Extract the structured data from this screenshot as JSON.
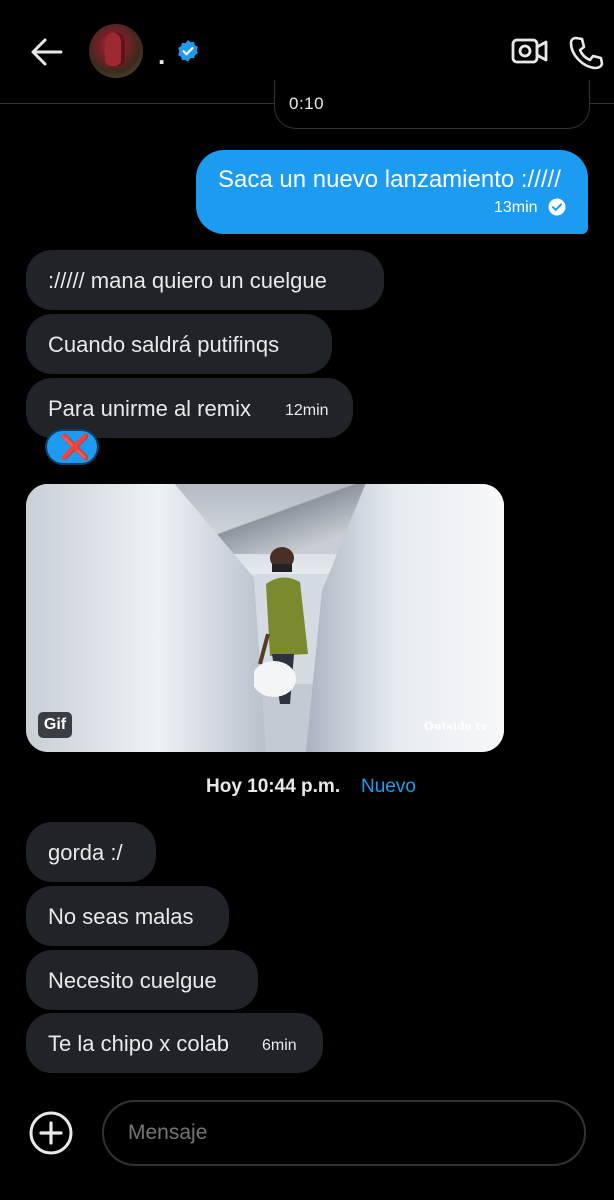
{
  "header": {
    "name": ".",
    "verified": true,
    "icons": [
      "back-arrow-icon",
      "verified-badge-icon",
      "video-call-icon",
      "phone-call-icon"
    ]
  },
  "previous_media": {
    "time": "0:10"
  },
  "sent_message": {
    "text": "Saca un nuevo lanzamiento ://///",
    "time": "13min",
    "status": "read"
  },
  "received_group_1": [
    {
      "text": ":///// mana quiero un cuelgue"
    },
    {
      "text": "Cuando saldrá putifinqs"
    },
    {
      "text": "Para unirme al remix",
      "time": "12min"
    }
  ],
  "reaction": {
    "emoji": "❌"
  },
  "gif": {
    "badge": "Gif",
    "watermark": "Outside tv"
  },
  "date_separator": {
    "label": "Hoy 10:44 p.m.",
    "new_label": "Nuevo"
  },
  "received_group_2": [
    {
      "text": "gorda :/"
    },
    {
      "text": "No seas malas"
    },
    {
      "text": "Necesito cuelgue"
    },
    {
      "text": "Te la chipo x colab",
      "time": "6min"
    }
  ],
  "composer": {
    "placeholder": "Mensaje"
  },
  "colors": {
    "accent": "#1d9bf0",
    "bubble_received": "#202327",
    "background": "#000000"
  }
}
